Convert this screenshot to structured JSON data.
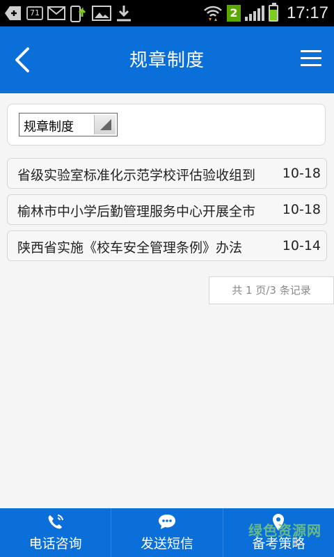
{
  "status_bar": {
    "badge_71": "71",
    "wifi_count": "2",
    "time": "17:17"
  },
  "header": {
    "title": "规章制度"
  },
  "filter": {
    "selected": "规章制度"
  },
  "articles": [
    {
      "title": "省级实验室标准化示范学校评估验收组到",
      "date": "10-18"
    },
    {
      "title": "榆林市中小学后勤管理服务中心开展全市",
      "date": "10-18"
    },
    {
      "title": "陕西省实施《校车安全管理条例》办法",
      "date": "10-14"
    }
  ],
  "pager": {
    "text": "共 1 页/3 条记录"
  },
  "bottom_nav": [
    {
      "label": "电话咨询",
      "icon": "phone-icon"
    },
    {
      "label": "发送短信",
      "icon": "chat-bubble-icon"
    },
    {
      "label": "备考策略",
      "icon": "location-pin-icon"
    }
  ],
  "watermark": "绿色资源网",
  "colors": {
    "primary": "#0a6fd9",
    "background": "#f5f5f5"
  }
}
